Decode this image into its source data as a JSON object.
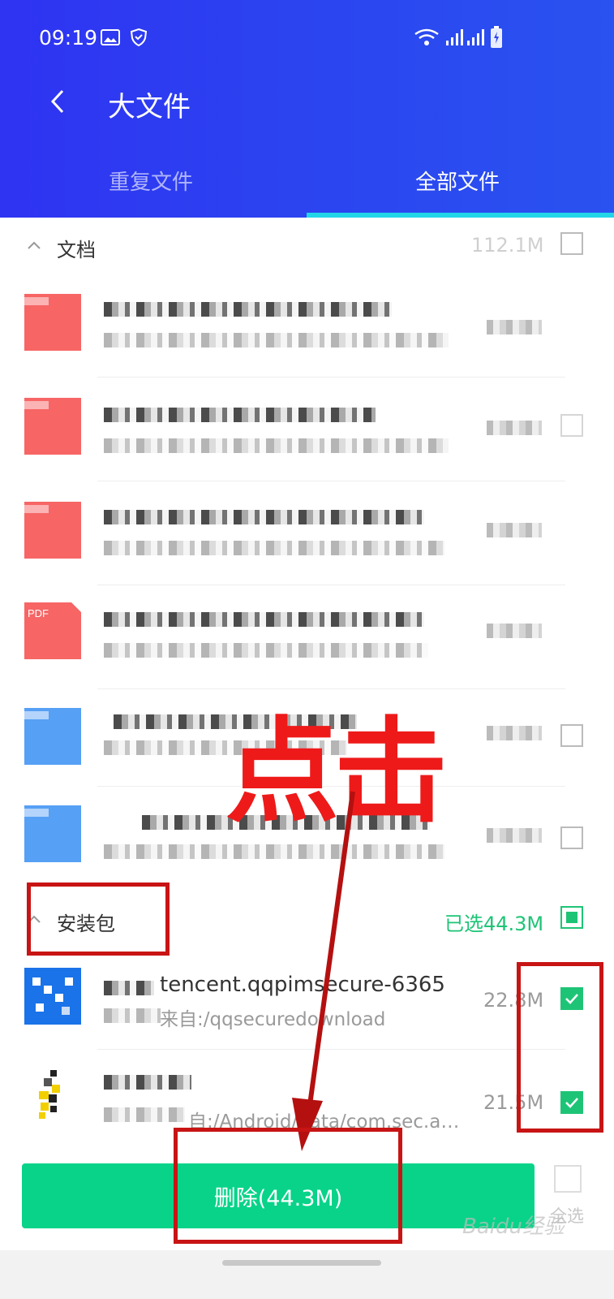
{
  "status_bar": {
    "time": "09:19"
  },
  "header": {
    "title": "大文件",
    "tabs": [
      {
        "label": "重复文件"
      },
      {
        "label": "全部文件"
      }
    ],
    "active_tab": 1
  },
  "documents": {
    "label": "文档",
    "size": "112.1M"
  },
  "packages": {
    "label": "安装包",
    "selected_text": "已选44.3M",
    "items": [
      {
        "name": "tencent.qqpimsecure-6365",
        "source": "来自:/qqsecuredownload",
        "size": "22.8M",
        "checked": true
      },
      {
        "name": "",
        "source": "自:/Android/data/com.sec.a…",
        "size": "21.5M",
        "checked": true
      }
    ]
  },
  "bottom": {
    "delete_label": "删除(44.3M)",
    "select_all_label": "全选"
  },
  "annotation": {
    "text": "点击"
  },
  "watermark": "Baidu经验",
  "colors": {
    "header": "#2f33f2",
    "accent_green": "#1ec476",
    "delete_button": "#08d389",
    "annotation_red": "#c81414"
  }
}
